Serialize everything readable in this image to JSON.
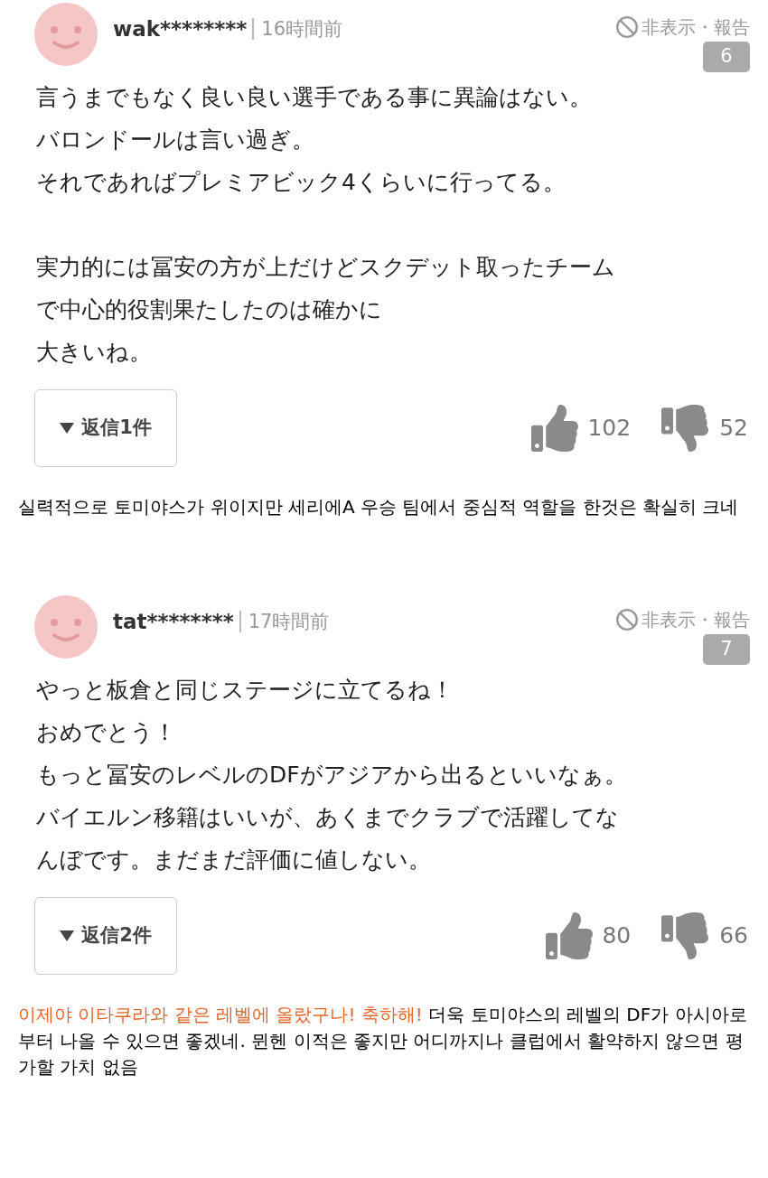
{
  "comments": [
    {
      "username": "wak********",
      "time": "16時間前",
      "actions": "非表示・報告",
      "badge": "6",
      "paragraphs": [
        [
          "言うまでもなく良い良い選手である事に異論はない。",
          "バロンドールは言い過ぎ。",
          "それであればプレミアビック4くらいに行ってる。"
        ],
        [
          "実力的には冨安の方が上だけどスクデット取ったチーム",
          "で中心的役割果たしたのは確かに",
          "大きいね。"
        ]
      ],
      "reply_button": "返信1件",
      "likes": "102",
      "dislikes": "52",
      "translation": [
        {
          "text": "실력적으로 토미야스가 위이지만 세리에A 우승 팀에서 중심적 역할을 한것은 확실히 크네",
          "highlighted": false
        }
      ]
    },
    {
      "username": "tat********",
      "time": "17時間前",
      "actions": "非表示・報告",
      "badge": "7",
      "paragraphs": [
        [
          "やっと板倉と同じステージに立てるね！",
          "おめでとう！",
          "もっと冨安のレベルのDFがアジアから出るといいなぁ。",
          "バイエルン移籍はいいが、あくまでクラブで活躍してな",
          "んぼです。まだまだ評価に値しない。"
        ]
      ],
      "reply_button": "返信2件",
      "likes": "80",
      "dislikes": "66",
      "translation": [
        {
          "text": "이제야 이타쿠라와 같은 레벨에 올랐구나! 축하해!",
          "highlighted": true
        },
        {
          "text": " 더욱 토미야스의 레벨의 DF가 아시아로부터 나올 수 있으면 좋겠네. 뮌헨 이적은 좋지만 어디까지나 클럽에서 활약하지 않으면 평가할 가치 없음",
          "highlighted": false
        }
      ]
    }
  ]
}
